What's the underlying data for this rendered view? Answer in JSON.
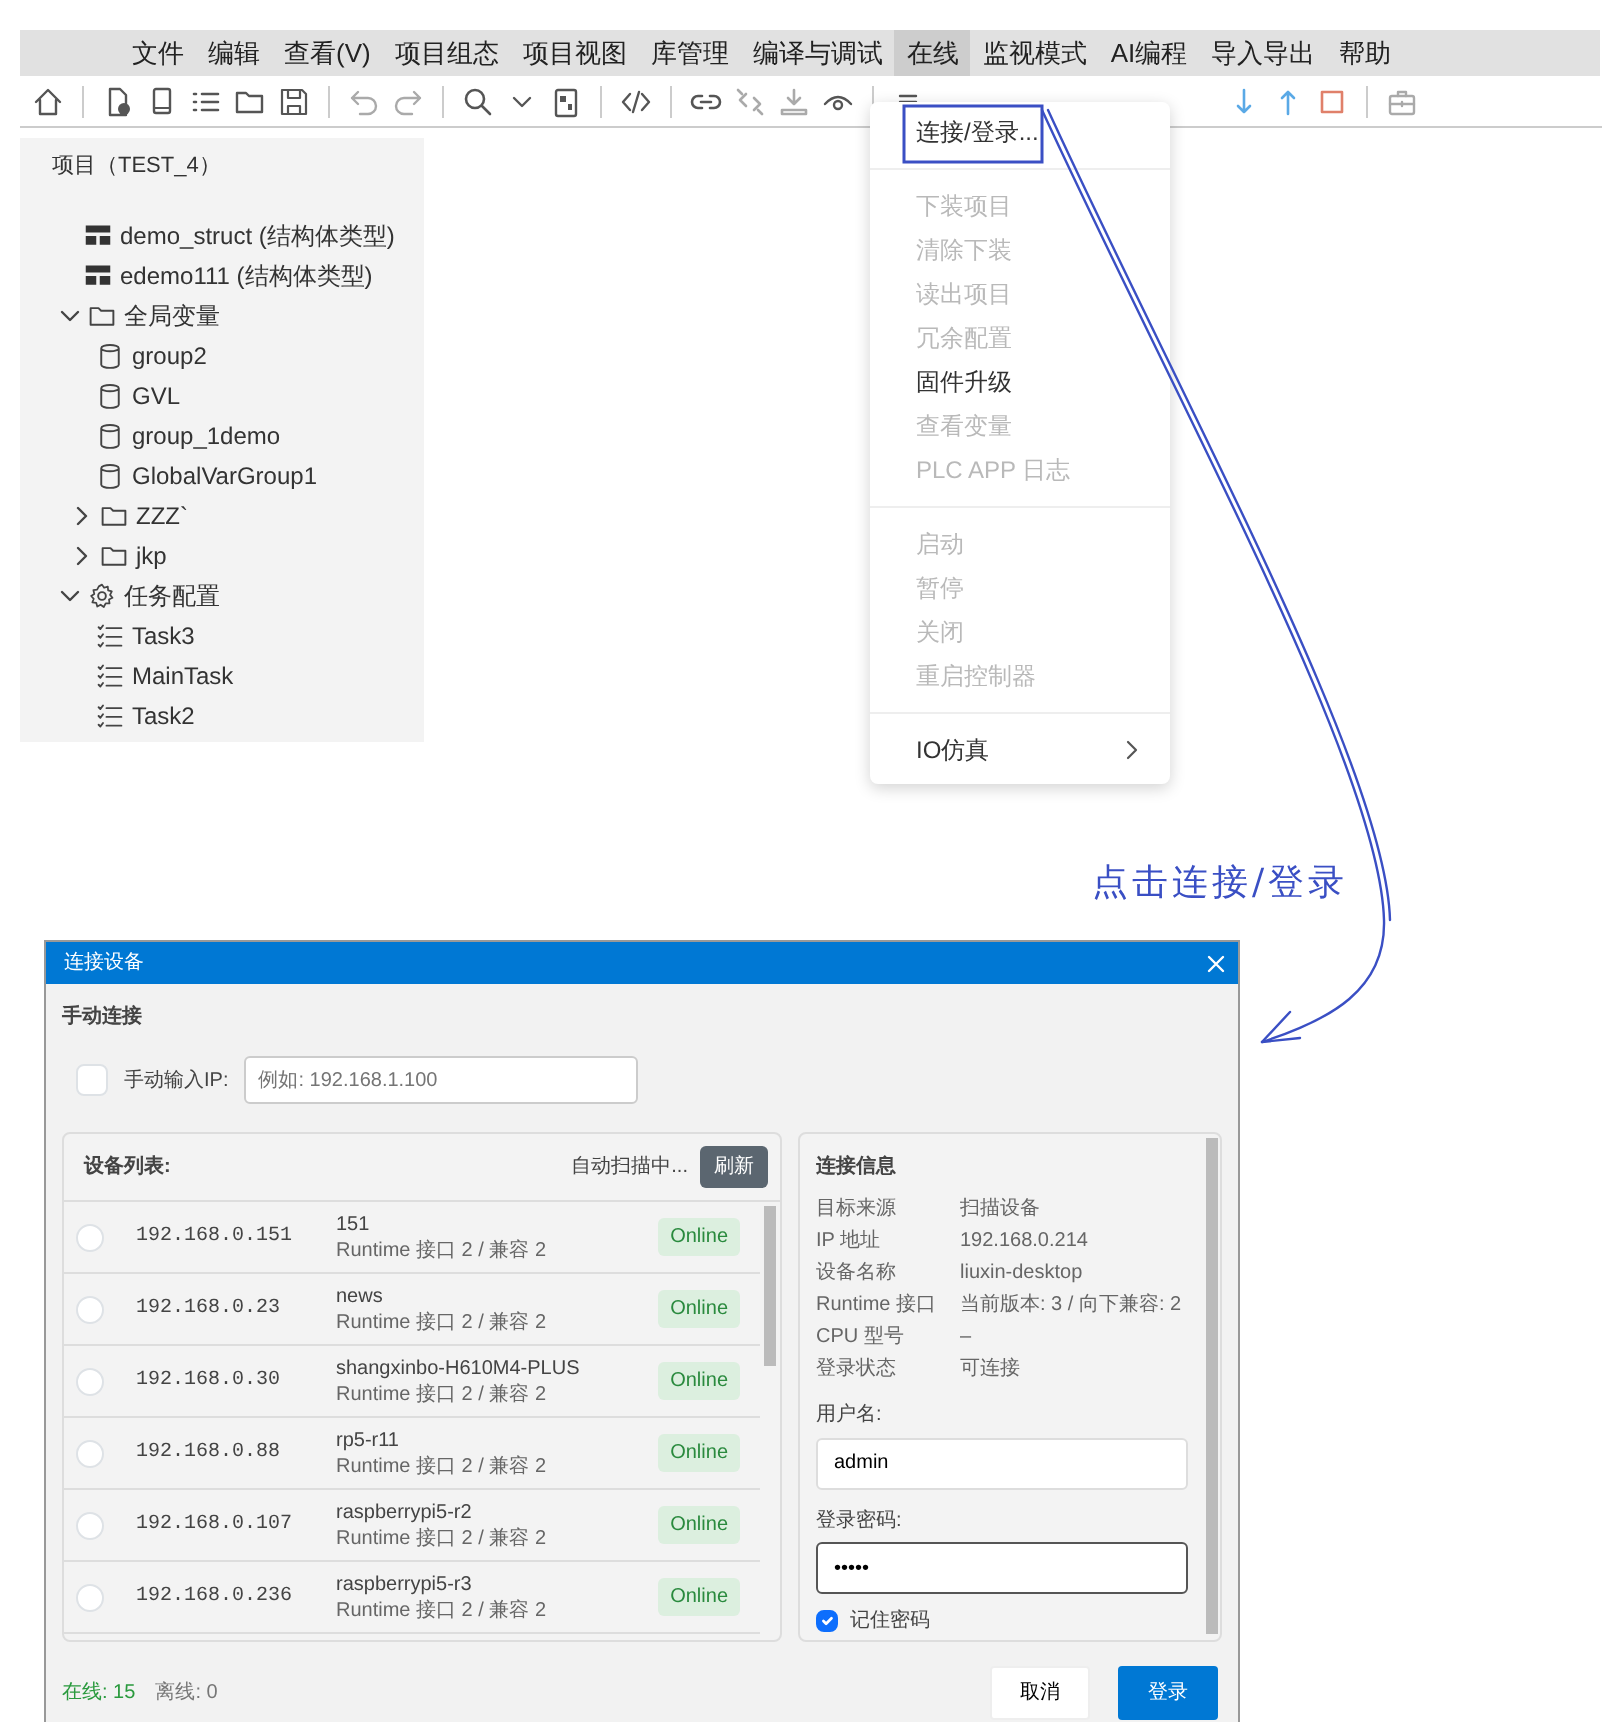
{
  "menu_bar": {
    "items": [
      {
        "label": "文件",
        "selected": false
      },
      {
        "label": "编辑",
        "selected": false
      },
      {
        "label": "查看(V)",
        "selected": false
      },
      {
        "label": "项目组态",
        "selected": false
      },
      {
        "label": "项目视图",
        "selected": false
      },
      {
        "label": "库管理",
        "selected": false
      },
      {
        "label": "编译与调试",
        "selected": false
      },
      {
        "label": "在线",
        "selected": true
      },
      {
        "label": "监视模式",
        "selected": false
      },
      {
        "label": "AI编程",
        "selected": false
      },
      {
        "label": "导入导出",
        "selected": false
      },
      {
        "label": "帮助",
        "selected": false
      }
    ]
  },
  "online_menu": {
    "groups": [
      [
        {
          "label": "连接/登录...",
          "disabled": false,
          "submenu": false
        }
      ],
      [
        {
          "label": "下装项目",
          "disabled": true,
          "submenu": false
        },
        {
          "label": "清除下装",
          "disabled": true,
          "submenu": false
        },
        {
          "label": "读出项目",
          "disabled": true,
          "submenu": false
        },
        {
          "label": "冗余配置",
          "disabled": true,
          "submenu": false
        },
        {
          "label": "固件升级",
          "disabled": false,
          "submenu": false
        },
        {
          "label": "查看变量",
          "disabled": true,
          "submenu": false
        },
        {
          "label": "PLC APP 日志",
          "disabled": true,
          "submenu": false
        }
      ],
      [
        {
          "label": "启动",
          "disabled": true,
          "submenu": false
        },
        {
          "label": "暂停",
          "disabled": true,
          "submenu": false
        },
        {
          "label": "关闭",
          "disabled": true,
          "submenu": false
        },
        {
          "label": "重启控制器",
          "disabled": true,
          "submenu": false
        }
      ],
      [
        {
          "label": "IO仿真",
          "disabled": false,
          "submenu": true
        }
      ]
    ]
  },
  "project_tree": {
    "title": "项目（TEST_4）",
    "items": [
      {
        "label": "demo_struct (结构体类型)",
        "kind": "struct"
      },
      {
        "label": "edemo111 (结构体类型)",
        "kind": "struct"
      },
      {
        "label": "全局变量",
        "kind": "folder",
        "expanded": true,
        "children": [
          {
            "label": "group2",
            "kind": "variables"
          },
          {
            "label": "GVL",
            "kind": "variables"
          },
          {
            "label": "group_1demo",
            "kind": "variables"
          },
          {
            "label": "GlobalVarGroup1",
            "kind": "variables"
          },
          {
            "label": "ZZZ`",
            "kind": "folder",
            "expanded": false
          },
          {
            "label": "jkp",
            "kind": "folder",
            "expanded": false
          }
        ]
      },
      {
        "label": "任务配置",
        "kind": "tasks",
        "expanded": true,
        "children": [
          {
            "label": "Task3",
            "kind": "task"
          },
          {
            "label": "MainTask",
            "kind": "task"
          },
          {
            "label": "Task2",
            "kind": "task"
          }
        ]
      }
    ]
  },
  "annotation": {
    "label": "点击连接/登录"
  },
  "dialog": {
    "title": "连接设备",
    "manual": {
      "heading": "手动连接",
      "checkbox_label": "手动输入IP:",
      "checked": false,
      "placeholder": "例如: 192.168.1.100"
    },
    "device_list": {
      "title": "设备列表:",
      "scan_status": "自动扫描中...",
      "refresh_button": "刷新",
      "devices": [
        {
          "ip": "192.168.0.151",
          "name": "151",
          "detail": "Runtime 接口 2 / 兼容 2",
          "status": "Online",
          "selected": false
        },
        {
          "ip": "192.168.0.23",
          "name": "news",
          "detail": "Runtime 接口 2 / 兼容 2",
          "status": "Online",
          "selected": false
        },
        {
          "ip": "192.168.0.30",
          "name": "shangxinbo-H610M4-PLUS",
          "detail": "Runtime 接口 2 / 兼容 2",
          "status": "Online",
          "selected": false
        },
        {
          "ip": "192.168.0.88",
          "name": "rp5-r11",
          "detail": "Runtime 接口 2 / 兼容 2",
          "status": "Online",
          "selected": false
        },
        {
          "ip": "192.168.0.107",
          "name": "raspberrypi5-r2",
          "detail": "Runtime 接口 2 / 兼容 2",
          "status": "Online",
          "selected": false
        },
        {
          "ip": "192.168.0.236",
          "name": "raspberrypi5-r3",
          "detail": "Runtime 接口 2 / 兼容 2",
          "status": "Online",
          "selected": false
        }
      ]
    },
    "connection_info": {
      "title": "连接信息",
      "fields": [
        {
          "label": "目标来源",
          "value": "扫描设备"
        },
        {
          "label": "IP 地址",
          "value": "192.168.0.214"
        },
        {
          "label": "设备名称",
          "value": "liuxin-desktop"
        },
        {
          "label": "Runtime 接口",
          "value": "当前版本: 3 / 向下兼容: 2"
        },
        {
          "label": "CPU 型号",
          "value": "–"
        },
        {
          "label": "登录状态",
          "value": "可连接"
        }
      ],
      "username_label": "用户名:",
      "username": "admin",
      "password_label": "登录密码:",
      "password": "•••••",
      "remember_label": "记住密码",
      "remember": true
    },
    "footer": {
      "online": "在线: 15",
      "offline": "离线: 0",
      "cancel_button": "取消",
      "login_button": "登录"
    }
  }
}
